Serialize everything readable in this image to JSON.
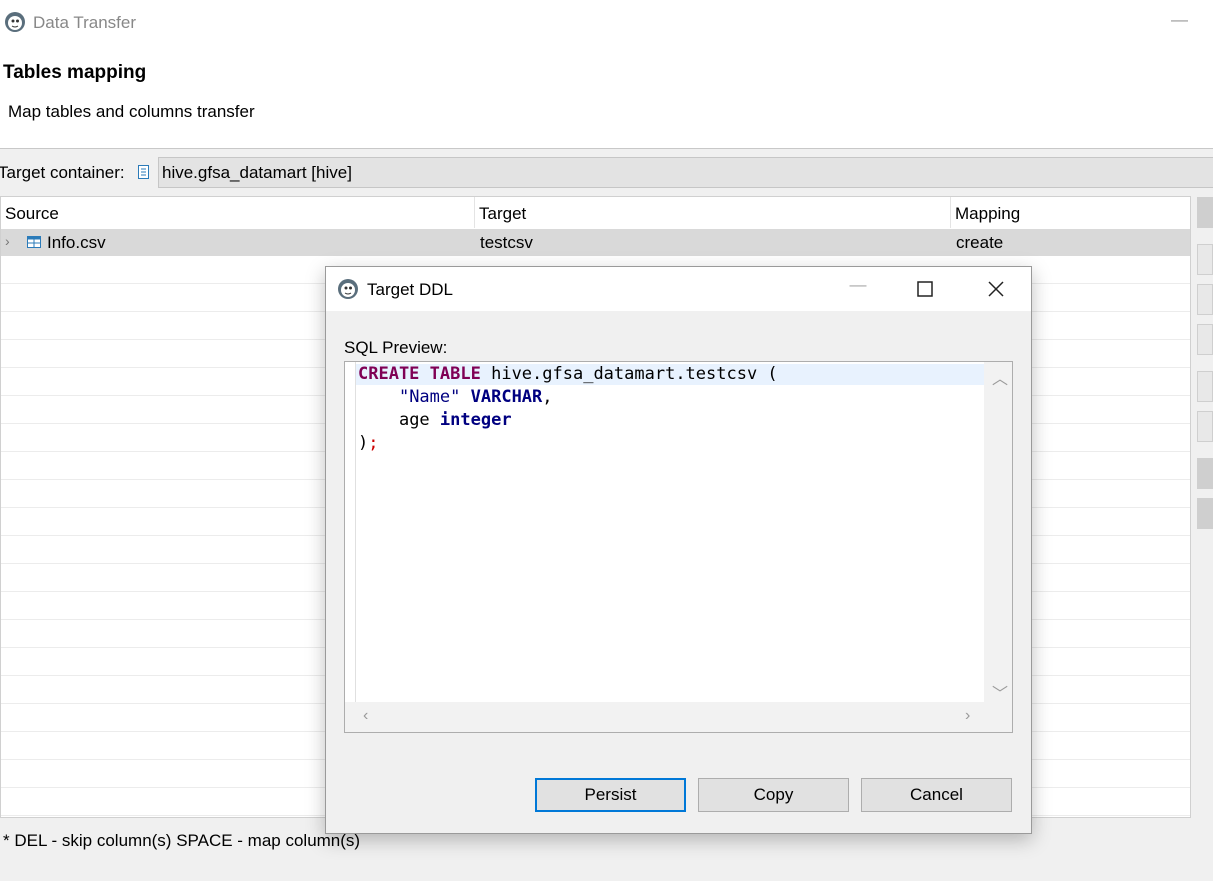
{
  "window": {
    "title": "Data Transfer",
    "minimize_glyph": "—"
  },
  "header": {
    "title": "Tables mapping",
    "description": "Map tables and columns transfer"
  },
  "target_container": {
    "label": "Target container:",
    "value": "hive.gfsa_datamart  [hive]"
  },
  "table": {
    "columns": [
      "Source",
      "Target",
      "Mapping"
    ],
    "rows": [
      {
        "source": "Info.csv",
        "target": "testcsv",
        "mapping": "create"
      }
    ]
  },
  "footer": {
    "hint": "* DEL - skip column(s)  SPACE - map column(s)"
  },
  "dialog": {
    "title": "Target DDL",
    "sql_label": "SQL Preview:",
    "sql": {
      "line1_kw1": "CREATE",
      "line1_kw2": "TABLE",
      "line1_rest": " hive.gfsa_datamart.testcsv (",
      "line2_str": "\"Name\"",
      "line2_type": "VARCHAR",
      "line2_tail": ",",
      "line3_name": "age",
      "line3_type": "integer",
      "line4_paren": ")",
      "line4_semi": ";"
    },
    "buttons": {
      "persist": "Persist",
      "copy": "Copy",
      "cancel": "Cancel"
    }
  },
  "colors": {
    "keyword": "#7f0055",
    "type": "#000080",
    "default_button_border": "#0078d7",
    "selected_row": "#d9d9d9"
  }
}
